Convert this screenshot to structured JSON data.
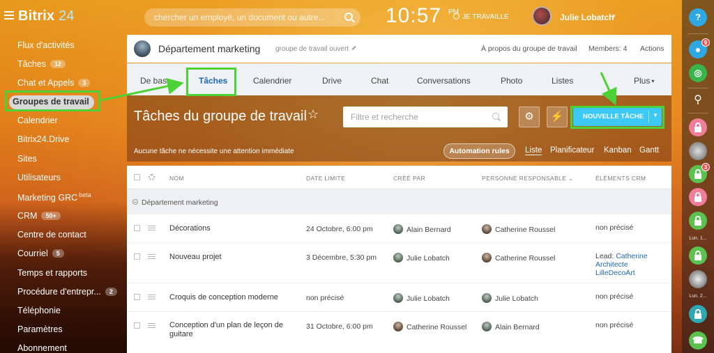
{
  "app": {
    "logo_text": "Bitrix",
    "logo_num": "24",
    "search_placeholder": "chercher un employé, un document ou autre...",
    "clock": "10:57",
    "clock_ampm": "PM",
    "work_status": "JE TRAVAILLE",
    "user_name": "Julie Lobatch"
  },
  "sidebar": {
    "items": [
      {
        "label": "Flux d'activités"
      },
      {
        "label": "Tâches",
        "badge": "12"
      },
      {
        "label": "Chat et Appels",
        "badge": "3"
      },
      {
        "label": "Groupes de travail",
        "active": true
      },
      {
        "label": "Calendrier"
      },
      {
        "label": "Bitrix24.Drive"
      },
      {
        "label": "Sites"
      },
      {
        "label": "Utilisateurs"
      },
      {
        "label": "Marketing GRC",
        "sup": "beta"
      },
      {
        "label": "CRM",
        "badge": "50+"
      },
      {
        "label": "Centre de contact"
      },
      {
        "label": "Courriel",
        "badge": "5"
      },
      {
        "label": "Temps et rapports"
      },
      {
        "label": "Procédure d'entrepr...",
        "badge": "2"
      },
      {
        "label": "Téléphonie"
      },
      {
        "label": "Paramètres"
      },
      {
        "label": "Abonnement"
      }
    ]
  },
  "rightbar": {
    "help": "?",
    "notif_badge": "9",
    "lock3_badge": "3",
    "label1": "Lun. 1...",
    "label2": "Lun. 2..."
  },
  "group": {
    "name": "Département marketing",
    "type": "groupe de travail ouvert",
    "about": "À propos du groupe de travail",
    "members": "Members: 4",
    "actions": "Actions"
  },
  "tabs": [
    {
      "label": "De base"
    },
    {
      "label": "Tâches",
      "active": true
    },
    {
      "label": "Calendrier"
    },
    {
      "label": "Drive"
    },
    {
      "label": "Chat"
    },
    {
      "label": "Conversations"
    },
    {
      "label": "Photo"
    },
    {
      "label": "Listes"
    },
    {
      "label": "Plus"
    }
  ],
  "tasks": {
    "title": "Tâches du groupe de travail",
    "filter_placeholder": "Filtre et recherche",
    "new_task": "NOUVELLE TÂCHE",
    "notice": "Aucune tâche ne nécessite une attention immédiate",
    "automation": "Automation rules",
    "views": [
      "Liste",
      "Planificateur",
      "Kanban",
      "Gantt"
    ]
  },
  "table": {
    "headers": {
      "name": "NOM",
      "deadline": "DATE LIMITE",
      "created_by": "CRÉÉ PAR",
      "responsible": "PERSONNE RESPONSABLE",
      "crm": "ÉLÉMENTS CRM"
    },
    "group_label": "Département marketing",
    "rows": [
      {
        "name": "Décorations",
        "deadline": "24 Octobre, 6:00 pm",
        "created_by": "Alain Bernard",
        "responsible": "Catherine Roussel",
        "crm": "non précisé"
      },
      {
        "name": "Nouveau projet",
        "deadline": "3 Décembre, 5:30 pm",
        "created_by": "Julie Lobatch",
        "responsible": "Catherine Roussel",
        "crm_prefix": "Lead:",
        "crm_line1": "Catherine",
        "crm_line2": "Architecte",
        "crm_line3": "LilleDecoArt"
      },
      {
        "name": "Croquis de conception moderne",
        "deadline": "non précisé",
        "created_by": "Julie Lobatch",
        "responsible": "Julie Lobatch",
        "crm": "non précisé"
      },
      {
        "name": "Conception d'un plan de leçon de guitare",
        "deadline": "31 Octobre, 6:00 pm",
        "created_by": "Catherine Roussel",
        "responsible": "Alain Bernard",
        "crm": "non précisé"
      }
    ]
  },
  "colors": {
    "accent_blue": "#3bc8f5",
    "link_blue": "#2067b0",
    "highlight_green": "#4cd137"
  }
}
